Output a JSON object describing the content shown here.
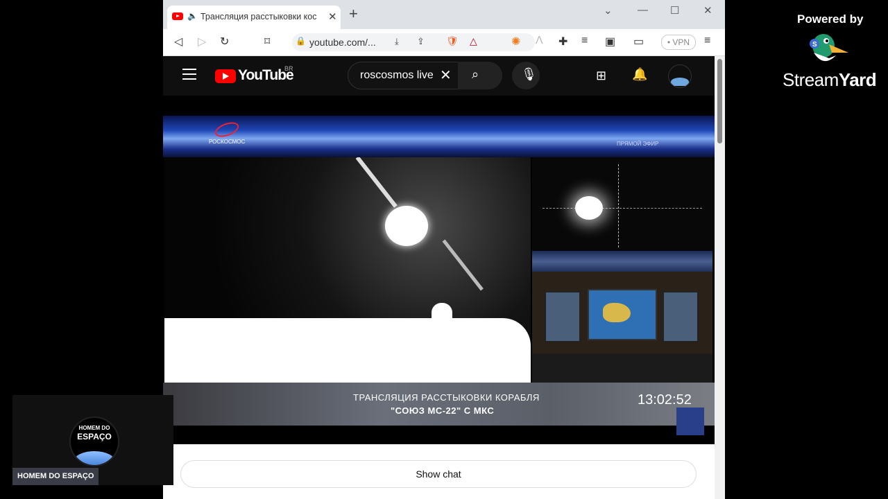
{
  "browser": {
    "tab_title": "Трансляция расстыковки кос",
    "new_tab": "+",
    "url": "youtube.com/...",
    "vpn": "• VPN"
  },
  "youtube": {
    "logo_text": "YouTube",
    "country_code": "BR",
    "search_value": "roscosmos live"
  },
  "video": {
    "brand": "РОСКОСМОС",
    "live_label": "ПРЯМОЙ ЭФИР",
    "caption_line1": "ТРАНСЛЯЦИЯ РАССТЫКОВКИ КОРАБЛЯ",
    "caption_line2": "\"СОЮЗ МС-22\" С МКС",
    "clock": "13:02:52"
  },
  "chat": {
    "show_chat_label": "Show chat"
  },
  "overlay": {
    "powered_by": "Powered by",
    "streamyard_regular": "Stream",
    "streamyard_bold": "Yard",
    "channel_logo_line1": "HOMEM DO",
    "channel_logo_line2": "ESPAÇO",
    "channel_name": "HOMEM DO ESPAÇO"
  },
  "colors": {
    "youtube_red": "#ff0000",
    "page_bg": "#000000"
  }
}
